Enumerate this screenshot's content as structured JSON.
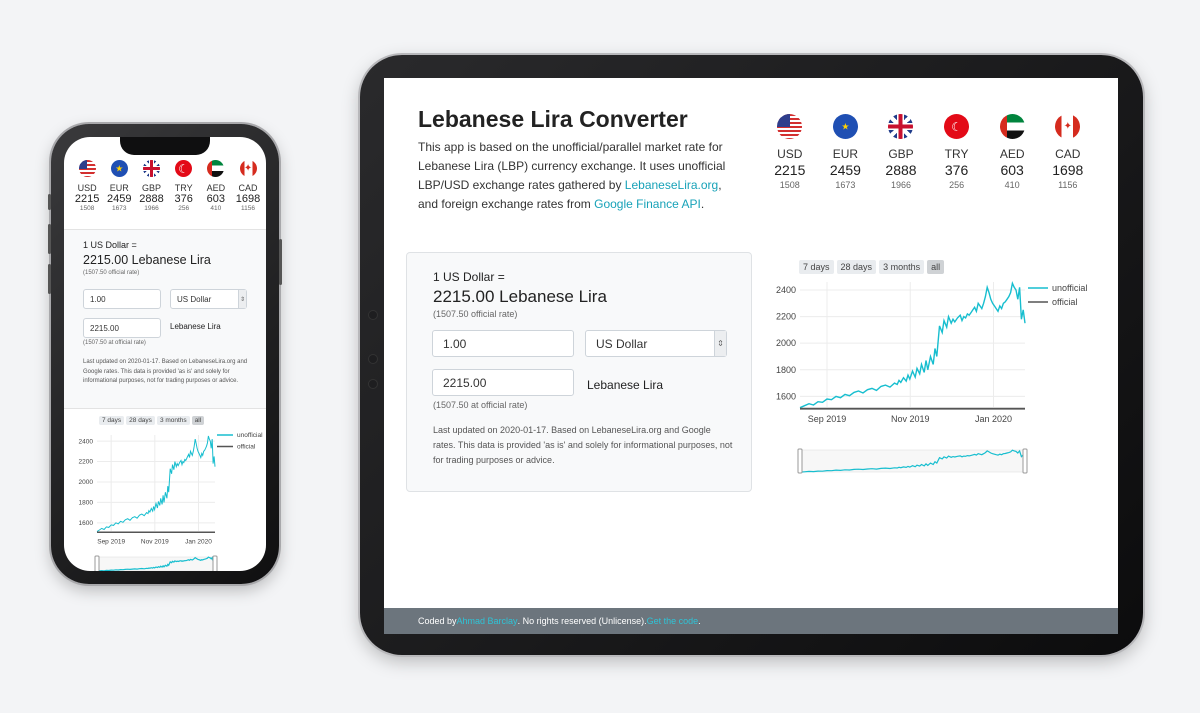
{
  "app": {
    "title": "Lebanese Lira Converter",
    "description_parts": {
      "part1": "This app is based on the unofficial/parallel market rate for Lebanese Lira (LBP) currency exchange. It uses unofficial LBP/USD exchange rates gathered by ",
      "link1": "LebaneseLira.org",
      "part2": ", and foreign exchange rates from ",
      "link2": "Google Finance API",
      "part3": "."
    }
  },
  "rates": [
    {
      "code": "USD",
      "flag": "us-flag-icon",
      "rate": "2215",
      "official": "1508"
    },
    {
      "code": "EUR",
      "flag": "eu-flag-icon",
      "rate": "2459",
      "official": "1673"
    },
    {
      "code": "GBP",
      "flag": "uk-flag-icon",
      "rate": "2888",
      "official": "1966"
    },
    {
      "code": "TRY",
      "flag": "tr-flag-icon",
      "rate": "376",
      "official": "256"
    },
    {
      "code": "AED",
      "flag": "ae-flag-icon",
      "rate": "603",
      "official": "410"
    },
    {
      "code": "CAD",
      "flag": "ca-flag-icon",
      "rate": "1698",
      "official": "1156"
    }
  ],
  "converter": {
    "from_label": "1 US Dollar =",
    "result": "2215.00 Lebanese Lira",
    "official_rate": "(1507.50 official rate)",
    "amount_value": "1.00",
    "currency_selected": "US Dollar",
    "output_value": "2215.00",
    "output_label": "Lebanese Lira",
    "output_official": "(1507.50 at official rate)",
    "note": "Last updated on 2020-01-17. Based on LebaneseLira.org and Google rates. This data is provided 'as is' and solely for informational purposes, not for trading purposes or advice."
  },
  "chart_controls": {
    "ranges": [
      "7 days",
      "28 days",
      "3 months",
      "all"
    ],
    "active": "all"
  },
  "footer": {
    "prefix": "Coded by ",
    "author": "Ahmad Barclay",
    "middle": ". No rights reserved (Unlicense). ",
    "code_link": "Get the code",
    "suffix": "."
  },
  "chart_data": {
    "type": "line",
    "x_ticks": [
      "Sep 2019",
      "Nov 2019",
      "Jan 2020"
    ],
    "y_ticks": [
      1600,
      1800,
      2000,
      2200,
      2400
    ],
    "ylim": [
      1520,
      2460
    ],
    "grid": true,
    "legend_position": "top-right",
    "series": [
      {
        "name": "unofficial",
        "color": "#17becf",
        "x": [
          0,
          5,
          10,
          15,
          20,
          25,
          30,
          35,
          40,
          45,
          50,
          55,
          60,
          65,
          70,
          75,
          80,
          85,
          90,
          95,
          100,
          105,
          108,
          110,
          112,
          115,
          118,
          120,
          122,
          125,
          128,
          130,
          133,
          135,
          138,
          140,
          142,
          145,
          148,
          150,
          152,
          155,
          158,
          160,
          163,
          165,
          168,
          170,
          172,
          175,
          178,
          180,
          182,
          184,
          186,
          188,
          190,
          192,
          194,
          196,
          198,
          200,
          202,
          204,
          206,
          208,
          210,
          212,
          214,
          216,
          218,
          220,
          222,
          224,
          226,
          228,
          230,
          232,
          234,
          236,
          238,
          240,
          242,
          244,
          246,
          248,
          250
        ],
        "y": [
          1515,
          1530,
          1545,
          1535,
          1560,
          1555,
          1580,
          1575,
          1600,
          1590,
          1615,
          1605,
          1630,
          1640,
          1625,
          1650,
          1660,
          1645,
          1675,
          1685,
          1670,
          1700,
          1690,
          1720,
          1705,
          1740,
          1715,
          1760,
          1730,
          1790,
          1745,
          1810,
          1770,
          1840,
          1780,
          1870,
          1800,
          1900,
          1840,
          1960,
          1900,
          2130,
          2080,
          2170,
          2120,
          2200,
          2150,
          2180,
          2160,
          2190,
          2210,
          2170,
          2200,
          2190,
          2220,
          2210,
          2230,
          2250,
          2270,
          2240,
          2300,
          2280,
          2260,
          2300,
          2350,
          2420,
          2380,
          2330,
          2300,
          2280,
          2260,
          2240,
          2280,
          2260,
          2300,
          2310,
          2330,
          2350,
          2380,
          2450,
          2420,
          2400,
          2330,
          2420,
          2180,
          2250,
          2150
        ]
      },
      {
        "name": "official",
        "color": "#555555",
        "x": [
          0,
          250
        ],
        "y": [
          1507.5,
          1507.5
        ]
      }
    ]
  }
}
